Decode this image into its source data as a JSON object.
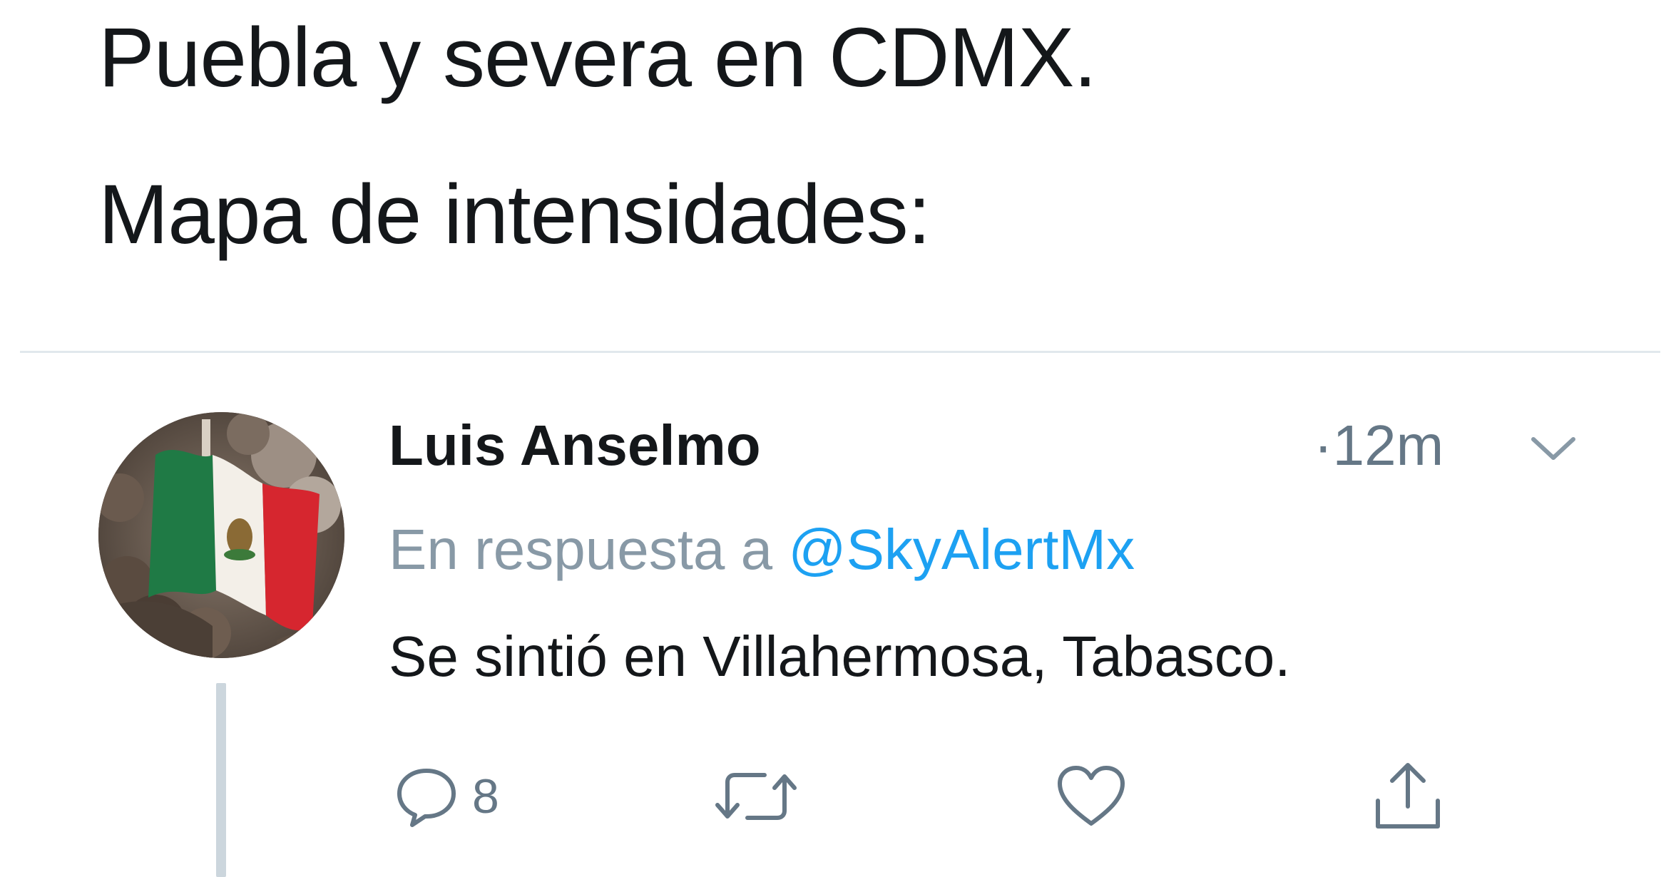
{
  "previous_tweet": {
    "lines": [
      "Puebla y severa en CDMX.",
      "Mapa de intensidades:"
    ]
  },
  "reply_tweet": {
    "author_name": "Luis Anselmo",
    "separator": "·",
    "timestamp": "12m",
    "reply_prefix": "En respuesta a",
    "reply_handle": "@SkyAlertMx",
    "body": "Se sintió en Villahermosa, Tabasco.",
    "avatar_icon": "mexico-flag-avatar",
    "actions": {
      "reply_count": "8",
      "reply_icon": "reply-icon",
      "retweet_icon": "retweet-icon",
      "like_icon": "heart-icon",
      "share_icon": "share-icon"
    }
  },
  "colors": {
    "text_primary": "#14171a",
    "text_secondary": "#657786",
    "link": "#1da1f2",
    "divider": "#e1e8ed",
    "thread_line": "#ccd6dd"
  }
}
